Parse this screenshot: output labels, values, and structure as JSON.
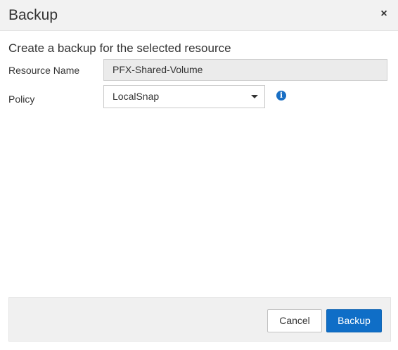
{
  "dialog": {
    "title": "Backup",
    "close_glyph": "×",
    "subtitle": "Create a backup for the selected resource"
  },
  "form": {
    "resource_name": {
      "label": "Resource Name",
      "value": "PFX-Shared-Volume"
    },
    "policy": {
      "label": "Policy",
      "selected": "LocalSnap",
      "info_glyph": "i"
    }
  },
  "footer": {
    "cancel_label": "Cancel",
    "backup_label": "Backup"
  },
  "icons": {
    "close": "close-icon",
    "dropdown": "caret-down-icon",
    "info": "info-icon"
  },
  "colors": {
    "primary_button": "#0f6ec7",
    "info_icon": "#1a6fc4",
    "header_bg": "#f2f2f2",
    "readonly_input_bg": "#ebebeb"
  }
}
